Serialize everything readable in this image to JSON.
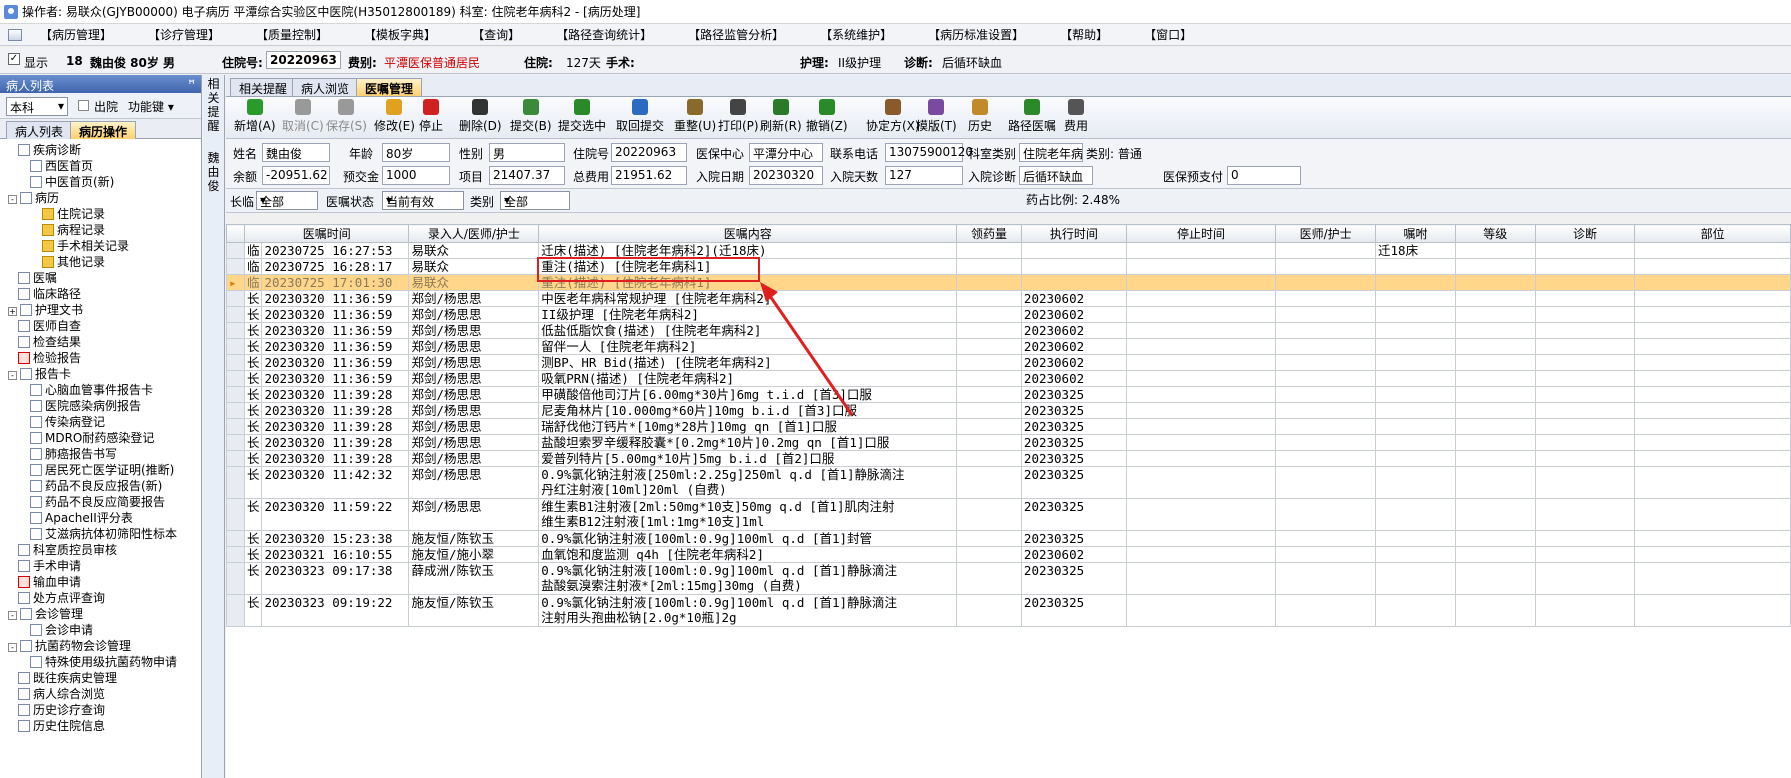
{
  "titlebar": {
    "text": "操作者: 易联众(GJYB00000) 电子病历  平潭综合实验区中医院(H35012800189)  科室: 住院老年病科2 - [病历处理]"
  },
  "menu": [
    "【病历管理】",
    "【诊疗管理】",
    "【质量控制】",
    "【模板字典】",
    "【查询】",
    "【路径查询统计】",
    "【路径监管分析】",
    "【系统维护】",
    "【病历标准设置】",
    "【帮助】",
    "【窗口】"
  ],
  "patientbar": {
    "show": "显示",
    "bed": "18",
    "name": "魏由俊 80岁 男",
    "inpatient_no_label": "住院号:",
    "inpatient_no": "20220963",
    "fee_type_label": "费别:",
    "fee_type": "平潭医保普通居民",
    "stay_label": "住院:",
    "stay": "127天",
    "surgery_label": "手术:",
    "nursing_label": "护理:",
    "nursing": "II级护理",
    "diagnosis_label": "诊断:",
    "diagnosis": "后循环缺血"
  },
  "leftpanel": {
    "title": "病人列表",
    "pin": "ꟸ",
    "dept": "本科",
    "discharged": "出院",
    "func": "功能键",
    "tab_list": "病人列表",
    "tab_ops": "病历操作",
    "tree": [
      "疾病诊断",
      "西医首页",
      "中医首页(新)",
      "病历",
      "住院记录",
      "病程记录",
      "手术相关记录",
      "其他记录",
      "医嘱",
      "临床路径",
      "护理文书",
      "医师自查",
      "检查结果",
      "检验报告",
      "报告卡",
      "心脑血管事件报告卡",
      "医院感染病例报告",
      "传染病登记",
      "MDRO耐药感染登记",
      "肺癌报告书写",
      "居民死亡医学证明(推断)",
      "药品不良反应报告(新)",
      "药品不良反应简要报告",
      "ApacheII评分表",
      "艾滋病抗体初筛阳性标本",
      "科室质控员审核",
      "手术申请",
      "输血申请",
      "处方点评查询",
      "会诊管理",
      "会诊申请",
      "抗菌药物会诊管理",
      "特殊使用级抗菌药物申请",
      "既往疾病史管理",
      "病人综合浏览",
      "历史诊疗查询",
      "历史住院信息"
    ]
  },
  "sidestrip": {
    "top": "相关提醒",
    "bottom": "魏由俊"
  },
  "tabs": [
    "相关提醒",
    "病人浏览",
    "医嘱管理"
  ],
  "toolbar": [
    "新增(A)",
    "取消(C)",
    "保存(S)",
    "修改(E)",
    "停止",
    "删除(D)",
    "提交(B)",
    "提交选中",
    "取回提交",
    "重整(U)",
    "打印(P)",
    "刷新(R)",
    "撤销(Z)",
    "协定方(X)",
    "模版(T)",
    "历史",
    "路径医嘱",
    "费用"
  ],
  "info": {
    "name_l": "姓名",
    "name": "魏由俊",
    "age_l": "年龄",
    "age": "80岁",
    "sex_l": "性别",
    "sex": "男",
    "no_l": "住院号",
    "no": "20220963",
    "ins_l": "医保中心",
    "ins": "平潭分中心",
    "tel_l": "联系电话",
    "tel": "13075900120",
    "dept_l": "科室类别",
    "dept": "住院老年病科",
    "cat": "类别: 普通",
    "bal_l": "余额",
    "bal": "-20951.62",
    "pre_l": "预交金",
    "pre": "1000",
    "item_l": "项目",
    "item": "21407.37",
    "total_l": "总费用",
    "total": "21951.62",
    "adm_l": "入院日期",
    "adm": "20230320",
    "days_l": "入院天数",
    "days": "127",
    "diag_l": "入院诊断",
    "diag": "后循环缺血",
    "prepay_l": "医保预支付",
    "prepay": "0"
  },
  "filter": {
    "term_l": "长临",
    "term": "全部",
    "state_l": "医嘱状态",
    "state": "当前有效",
    "type_l": "类别",
    "type": "全部",
    "ratio": "药占比例: 2.48%"
  },
  "columns": [
    "医嘱时间",
    "录入人/医师/护士",
    "医嘱内容",
    "领药量",
    "执行时间",
    "停止时间",
    "医师/护士",
    "嘱咐",
    "等级",
    "诊断",
    "部位"
  ],
  "rows": [
    {
      "t": "临",
      "time": "20230725 16:27:53",
      "who": "易联众",
      "c1": "迁床(描述)    [住院老年病科2](迁18床)",
      "c2": "",
      "exec": "",
      "note": "迁18床"
    },
    {
      "t": "临",
      "time": "20230725 16:28:17",
      "who": "易联众",
      "c1": "重注(描述)    [住院老年病科1]",
      "c2": "",
      "exec": "",
      "note": ""
    },
    {
      "t": "临",
      "time": "20230725 17:01:30",
      "who": "易联众",
      "c1": "重注(描述)    [住院老年病科1]",
      "c2": "",
      "exec": "",
      "note": "",
      "sel": true
    },
    {
      "t": "长",
      "time": "20230320 11:36:59",
      "who": "郑剑/杨思思",
      "c1": "中医老年病科常规护理    [住院老年病科2]",
      "c2": "",
      "exec": "20230602",
      "note": ""
    },
    {
      "t": "长",
      "time": "20230320 11:36:59",
      "who": "郑剑/杨思思",
      "c1": "II级护理    [住院老年病科2]",
      "c2": "",
      "exec": "20230602",
      "note": ""
    },
    {
      "t": "长",
      "time": "20230320 11:36:59",
      "who": "郑剑/杨思思",
      "c1": "低盐低脂饮食(描述)    [住院老年病科2]",
      "c2": "",
      "exec": "20230602",
      "note": ""
    },
    {
      "t": "长",
      "time": "20230320 11:36:59",
      "who": "郑剑/杨思思",
      "c1": "留伴一人    [住院老年病科2]",
      "c2": "",
      "exec": "20230602",
      "note": ""
    },
    {
      "t": "长",
      "time": "20230320 11:36:59",
      "who": "郑剑/杨思思",
      "c1": "测BP、HR Bid(描述)    [住院老年病科2]",
      "c2": "",
      "exec": "20230602",
      "note": ""
    },
    {
      "t": "长",
      "time": "20230320 11:36:59",
      "who": "郑剑/杨思思",
      "c1": "吸氧PRN(描述)    [住院老年病科2]",
      "c2": "",
      "exec": "20230602",
      "note": ""
    },
    {
      "t": "长",
      "time": "20230320 11:39:28",
      "who": "郑剑/杨思思",
      "c1": "甲磺酸倍他司汀片[6.00mg*30片]6mg t.i.d [首3]口服",
      "c2": "",
      "exec": "20230325",
      "note": ""
    },
    {
      "t": "长",
      "time": "20230320 11:39:28",
      "who": "郑剑/杨思思",
      "c1": "尼麦角林片[10.000mg*60片]10mg b.i.d [首3]口服",
      "c2": "",
      "exec": "20230325",
      "note": ""
    },
    {
      "t": "长",
      "time": "20230320 11:39:28",
      "who": "郑剑/杨思思",
      "c1": "瑞舒伐他汀钙片*[10mg*28片]10mg qn [首1]口服",
      "c2": "",
      "exec": "20230325",
      "note": ""
    },
    {
      "t": "长",
      "time": "20230320 11:39:28",
      "who": "郑剑/杨思思",
      "c1": "盐酸坦索罗辛缓释胶囊*[0.2mg*10片]0.2mg qn [首1]口服",
      "c2": "",
      "exec": "20230325",
      "note": ""
    },
    {
      "t": "长",
      "time": "20230320 11:39:28",
      "who": "郑剑/杨思思",
      "c1": "爱普列特片[5.00mg*10片]5mg b.i.d [首2]口服",
      "c2": "",
      "exec": "20230325",
      "note": ""
    },
    {
      "t": "长",
      "time": "20230320 11:42:32",
      "who": "郑剑/杨思思",
      "c1": "0.9%氯化钠注射液[250ml:2.25g]250ml q.d [首1]静脉滴注",
      "c2": "丹红注射液[10ml]20ml (自费)",
      "exec": "20230325",
      "note": ""
    },
    {
      "t": "长",
      "time": "20230320 11:59:22",
      "who": "郑剑/杨思思",
      "c1": "维生素B1注射液[2ml:50mg*10支]50mg q.d [首1]肌肉注射",
      "c2": "维生素B12注射液[1ml:1mg*10支]1ml",
      "exec": "20230325",
      "note": ""
    },
    {
      "t": "长",
      "time": "20230320 15:23:38",
      "who": "施友恒/陈钦玉",
      "c1": "0.9%氯化钠注射液[100ml:0.9g]100ml q.d [首1]封管",
      "c2": "",
      "exec": "20230325",
      "note": ""
    },
    {
      "t": "长",
      "time": "20230321 16:10:55",
      "who": "施友恒/施小翠",
      "c1": "血氧饱和度监测  q4h  [住院老年病科2]",
      "c2": "",
      "exec": "20230602",
      "note": ""
    },
    {
      "t": "长",
      "time": "20230323 09:17:38",
      "who": "薛成洲/陈钦玉",
      "c1": "0.9%氯化钠注射液[100ml:0.9g]100ml      q.d [首1]静脉滴注",
      "c2": "盐酸氨溴索注射液*[2ml:15mg]30mg (自费)",
      "exec": "20230325",
      "note": ""
    },
    {
      "t": "长",
      "time": "20230323 09:19:22",
      "who": "施友恒/陈钦玉",
      "c1": "0.9%氯化钠注射液[100ml:0.9g]100ml q.d [首1]静脉滴注",
      "c2": "注射用头孢曲松钠[2.0g*10瓶]2g",
      "exec": "20230325",
      "note": ""
    }
  ]
}
